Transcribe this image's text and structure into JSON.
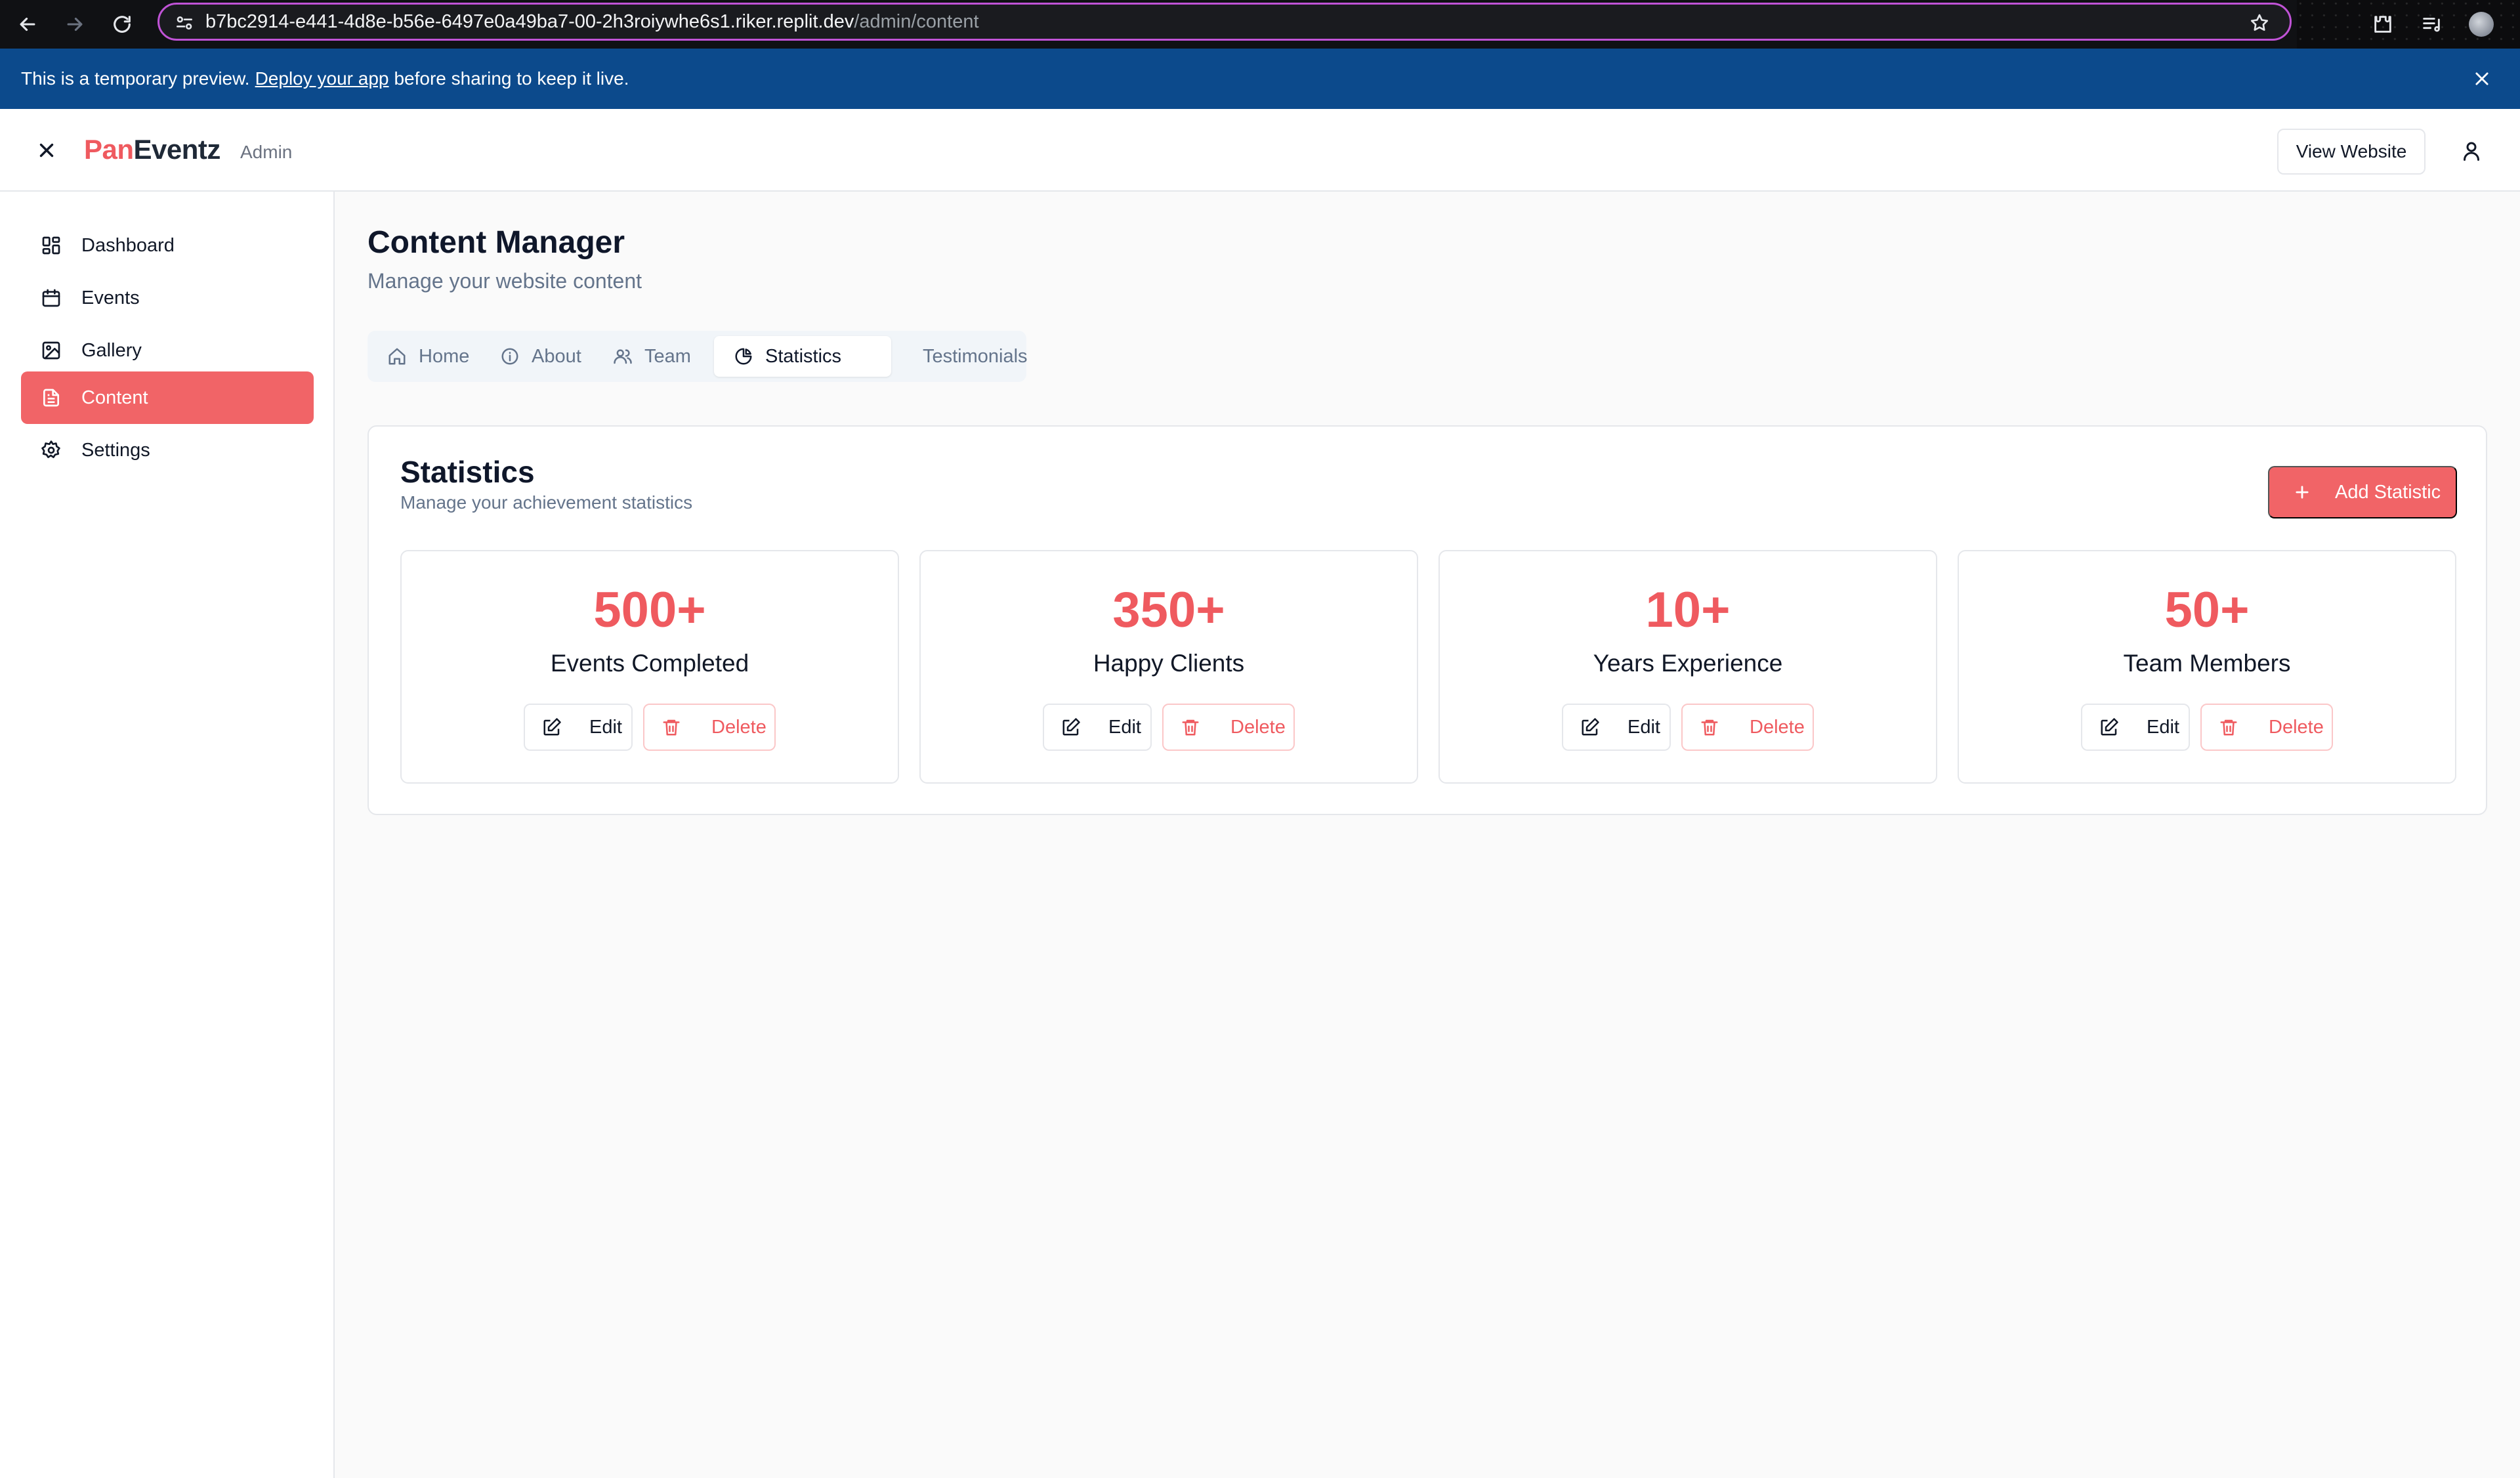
{
  "browser": {
    "url_host": "b7bc2914-e441-4d8e-b56e-6497e0a49ba7-00-2h3roiywhe6s1.riker.replit.dev",
    "url_path": "/admin/content"
  },
  "banner": {
    "prefix": "This is a temporary preview.",
    "link": "Deploy your app",
    "suffix": "before sharing to keep it live."
  },
  "header": {
    "brand_pan": "Pan",
    "brand_eventz": "Eventz",
    "brand_admin": "Admin",
    "view_website": "View Website"
  },
  "sidebar": {
    "items": [
      {
        "label": "Dashboard",
        "icon": "dashboard-grid-icon"
      },
      {
        "label": "Events",
        "icon": "calendar-icon"
      },
      {
        "label": "Gallery",
        "icon": "image-icon"
      },
      {
        "label": "Content",
        "icon": "document-icon",
        "active": true
      },
      {
        "label": "Settings",
        "icon": "gear-icon"
      }
    ]
  },
  "page": {
    "title": "Content Manager",
    "subtitle": "Manage your website content"
  },
  "tabs": [
    {
      "label": "Home",
      "icon": "home-icon"
    },
    {
      "label": "About",
      "icon": "info-icon"
    },
    {
      "label": "Team",
      "icon": "users-icon"
    },
    {
      "label": "Statistics",
      "icon": "pie-chart-icon",
      "active": true
    },
    {
      "label": "Testimonials",
      "icon": "award-icon"
    }
  ],
  "statistics": {
    "title": "Statistics",
    "subtitle": "Manage your achievement statistics",
    "add_label": "Add Statistic",
    "edit_label": "Edit",
    "delete_label": "Delete",
    "items": [
      {
        "value": "500+",
        "label": "Events Completed"
      },
      {
        "value": "350+",
        "label": "Happy Clients"
      },
      {
        "value": "10+",
        "label": "Years Experience"
      },
      {
        "value": "50+",
        "label": "Team Members"
      }
    ]
  },
  "colors": {
    "accent": "#f16467",
    "banner": "#0c4a8c",
    "stat_value": "#ef5a5f"
  }
}
